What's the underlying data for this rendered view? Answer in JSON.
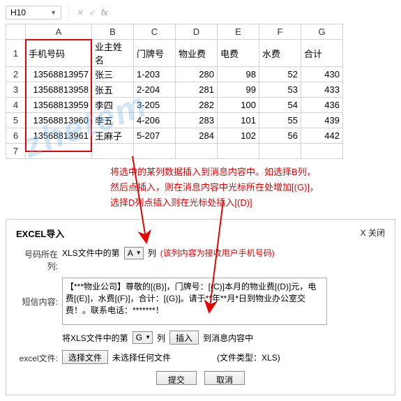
{
  "name_box": "H10",
  "fx_label": "fx",
  "columns": [
    "A",
    "B",
    "C",
    "D",
    "E",
    "F",
    "G"
  ],
  "rows": [
    "1",
    "2",
    "3",
    "4",
    "5",
    "6",
    "7"
  ],
  "header_row": {
    "A": "手机号码",
    "B": "业主姓名",
    "C": "门牌号",
    "D": "物业费",
    "E": "电费",
    "F": "水费",
    "G": "合计"
  },
  "data_rows": [
    {
      "A": "13568813957",
      "B": "张三",
      "C": "1-203",
      "D": "280",
      "E": "98",
      "F": "52",
      "G": "430"
    },
    {
      "A": "13568813958",
      "B": "张五",
      "C": "2-204",
      "D": "281",
      "E": "99",
      "F": "53",
      "G": "433"
    },
    {
      "A": "13568813959",
      "B": "李四",
      "C": "3-205",
      "D": "282",
      "E": "100",
      "F": "54",
      "G": "436"
    },
    {
      "A": "13568813960",
      "B": "李五",
      "C": "4-206",
      "D": "283",
      "E": "101",
      "F": "55",
      "G": "439"
    },
    {
      "A": "13568813961",
      "B": "王麻子",
      "C": "5-207",
      "D": "284",
      "E": "102",
      "F": "56",
      "G": "442"
    }
  ],
  "annotation": {
    "line1": "将选中的某列数据插入到消息内容中。如选择B列，",
    "line2": "然后点插入，则在消息内容中光标所在处增加[(G)]，",
    "line3": "选择D列点插入则在光标处插入[(D)]"
  },
  "dialog": {
    "title": "EXCEL导入",
    "close": "X 关闭",
    "phone_col_label": "号码所在列:",
    "phone_col_prefix": "XLS文件中的第",
    "phone_col_value": "A",
    "phone_col_suffix": "列",
    "phone_col_hint": "(该列内容为接收用户手机号码)",
    "msg_label": "短信内容:",
    "msg_value": "【***物业公司】尊敬的[(B)]，门牌号：[(C)]本月的物业费[(D)]元，电费[(E)]，水费[(F)]，合计：[(G)]。请于**年**月*日到物业办公室交费！。联系电话：*******！",
    "insert_prefix": "将XLS文件中的第",
    "insert_col_value": "G",
    "insert_col_suffix": "列",
    "insert_btn": "插入",
    "insert_suffix": "到消息内容中",
    "file_label": "excel文件:",
    "file_btn": "选择文件",
    "file_status": "未选择任何文件",
    "file_type": "(文件类型：XLS)",
    "submit": "提交",
    "cancel": "取消"
  },
  "watermark": "zhetem"
}
